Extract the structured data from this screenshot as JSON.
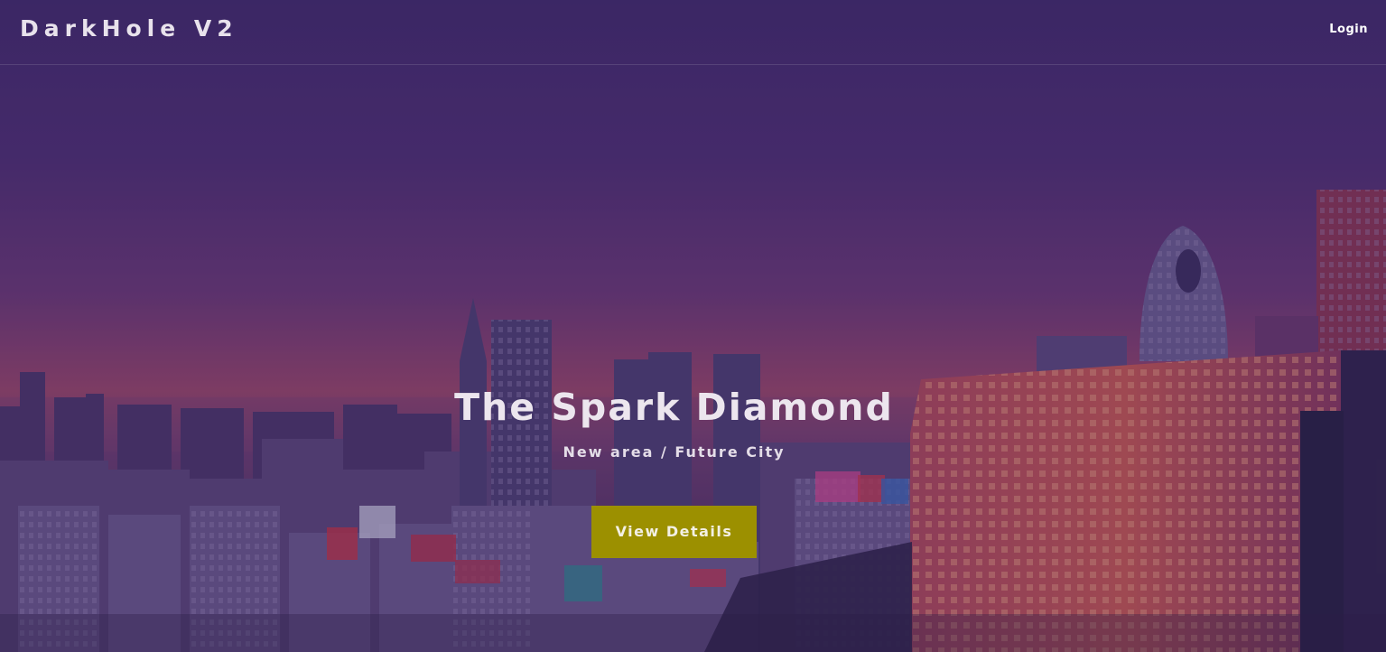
{
  "navbar": {
    "brand": "DarkHole V2",
    "login_label": "Login"
  },
  "hero": {
    "title": "The Spark Diamond",
    "subtitle": "New area / Future City",
    "cta_label": "View Details"
  },
  "colors": {
    "cta_background": "#9c9000",
    "overlay": "#3e2a66",
    "text": "#ece6ee"
  }
}
